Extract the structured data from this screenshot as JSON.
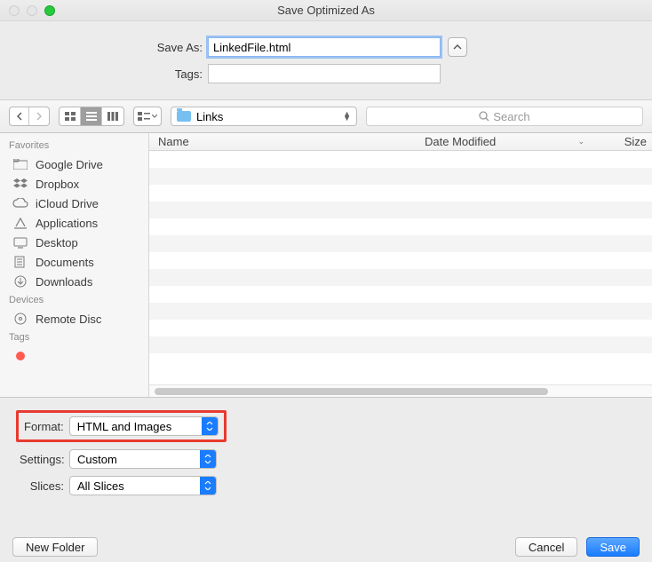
{
  "window": {
    "title": "Save Optimized As"
  },
  "form": {
    "saveas_label": "Save As:",
    "saveas_value": "LinkedFile.html",
    "tags_label": "Tags:",
    "tags_value": ""
  },
  "toolbar": {
    "location": "Links",
    "search_placeholder": "Search"
  },
  "sidebar": {
    "favorites_header": "Favorites",
    "items": [
      {
        "label": "Google Drive",
        "icon": "folder-icon"
      },
      {
        "label": "Dropbox",
        "icon": "dropbox-icon"
      },
      {
        "label": "iCloud Drive",
        "icon": "cloud-icon"
      },
      {
        "label": "Applications",
        "icon": "applications-icon"
      },
      {
        "label": "Desktop",
        "icon": "desktop-icon"
      },
      {
        "label": "Documents",
        "icon": "documents-icon"
      },
      {
        "label": "Downloads",
        "icon": "downloads-icon"
      }
    ],
    "devices_header": "Devices",
    "devices": [
      {
        "label": "Remote Disc",
        "icon": "disc-icon"
      }
    ],
    "tags_header": "Tags"
  },
  "list": {
    "col_name": "Name",
    "col_date": "Date Modified",
    "col_size": "Size"
  },
  "options": {
    "format_label": "Format:",
    "format_value": "HTML and Images",
    "settings_label": "Settings:",
    "settings_value": "Custom",
    "slices_label": "Slices:",
    "slices_value": "All Slices"
  },
  "footer": {
    "newfolder": "New Folder",
    "cancel": "Cancel",
    "save": "Save"
  }
}
